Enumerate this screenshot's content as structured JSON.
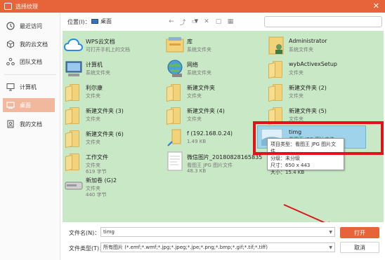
{
  "window": {
    "title": "选择纹理"
  },
  "sidebar": {
    "items": [
      {
        "label": "最近访问"
      },
      {
        "label": "我的云文档"
      },
      {
        "label": "团队文档"
      },
      {
        "label": "计算机"
      },
      {
        "label": "桌面"
      },
      {
        "label": "我的文档"
      }
    ]
  },
  "toolbar": {
    "location_label": "位置(I)：",
    "location_value": "桌面"
  },
  "files": [
    {
      "name": "WPS云文档",
      "line1": "可打开手机上的文档",
      "line2": ""
    },
    {
      "name": "库",
      "line1": "系统文件夹",
      "line2": ""
    },
    {
      "name": "Administrator",
      "line1": "系统文件夹",
      "line2": ""
    },
    {
      "name": "计算机",
      "line1": "系统文件夹",
      "line2": ""
    },
    {
      "name": "网络",
      "line1": "系统文件夹",
      "line2": ""
    },
    {
      "name": "wybActivexSetup",
      "line1": "文件夹",
      "line2": ""
    },
    {
      "name": "利尔康",
      "line1": "文件夹",
      "line2": ""
    },
    {
      "name": "新建文件夹",
      "line1": "文件夹",
      "line2": ""
    },
    {
      "name": "新建文件夹 (2)",
      "line1": "文件夹",
      "line2": ""
    },
    {
      "name": "新建文件夹 (3)",
      "line1": "文件夹",
      "line2": ""
    },
    {
      "name": "新建文件夹 (4)",
      "line1": "文件夹",
      "line2": ""
    },
    {
      "name": "新建文件夹 (5)",
      "line1": "文件夹",
      "line2": ""
    },
    {
      "name": "新建文件夹 (6)",
      "line1": "文件夹",
      "line2": ""
    },
    {
      "name": "f (192.168.0.24)",
      "line1": "1.49 KB",
      "line2": ""
    },
    {
      "name": "timg",
      "line1": "看图王 JPG 图片文件",
      "line2": ""
    },
    {
      "name": "工作文件",
      "line1": "文件夹",
      "line2": "619 字节"
    },
    {
      "name": "微信图片_20180828165835",
      "line1": "看图王 JPG 图片文件",
      "line2": "48.3 KB"
    },
    {
      "name": "新加卷 (G)2",
      "line1": "文件夹",
      "line2": "440 字节"
    }
  ],
  "tooltip": {
    "line1": "项目类型：看图王 JPG 图片文件",
    "line2": "分级：未分级",
    "line3": "尺寸：650 x 443",
    "line4": "大小：15.4 KB"
  },
  "bottom": {
    "filename_label": "文件名(N)：",
    "filename_value": "timg",
    "filetype_label": "文件类型(T)：",
    "filetype_value": "所有图片 (*.emf;*.wmf;*.jpg;*.jpeg;*.jpe;*.png;*.bmp;*.gif;*.tif;*.tiff)",
    "open_label": "打开",
    "cancel_label": "取消"
  },
  "colors": {
    "accent": "#e7643a",
    "pane": "#c9e8c6",
    "highlight": "#e3111a"
  }
}
